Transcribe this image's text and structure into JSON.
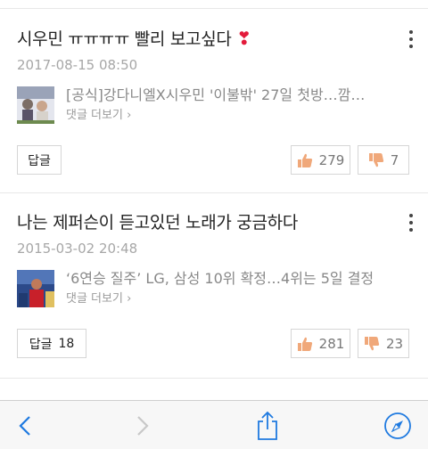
{
  "comments": [
    {
      "text": "시우민 ㅠㅠㅠㅠ 빨리 보고싶다",
      "heart": "❣",
      "date": "2017-08-15 08:50",
      "article_title": "[공식]강다니엘X시우민 '이불밖' 27일 첫방…깜…",
      "more_comments": "댓글 더보기",
      "reply_label": "답글",
      "reply_count": "",
      "likes": "279",
      "dislikes": "7"
    },
    {
      "text": "나는 제퍼슨이 듣고있던 노래가 궁금하다",
      "heart": "",
      "date": "2015-03-02 20:48",
      "article_title": "‘6연승 질주’ LG, 삼성 10위 확정…4위는 5일 결정",
      "more_comments": "댓글 더보기",
      "reply_label": "답글",
      "reply_count": "18",
      "likes": "281",
      "dislikes": "23"
    }
  ],
  "colors": {
    "accent": "#1f7ae0",
    "like_icon": "#f0a87a",
    "dislike_icon": "#f0a87a",
    "disabled": "#c8c8c8"
  },
  "toolbar": {
    "back": "chevron-left-icon",
    "forward": "chevron-right-icon",
    "share": "share-icon",
    "compass": "compass-icon"
  }
}
